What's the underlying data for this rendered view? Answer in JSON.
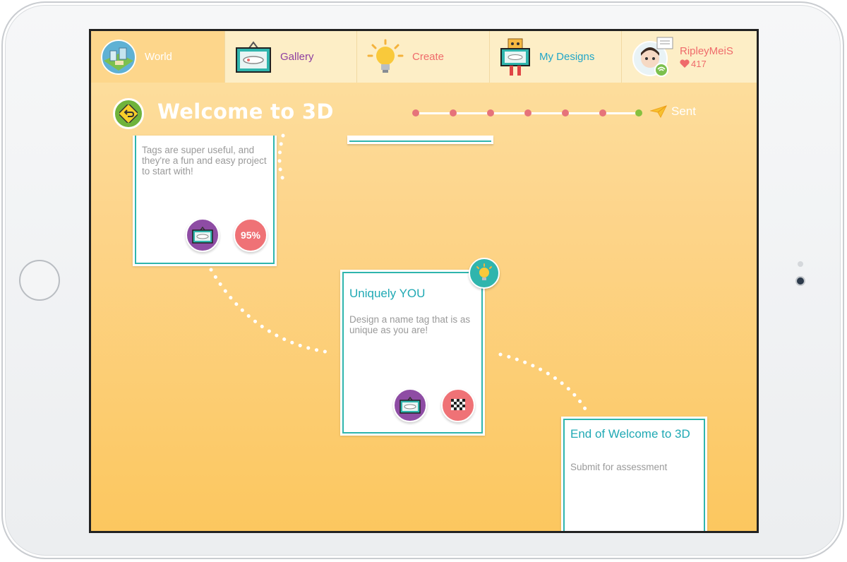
{
  "nav": {
    "tabs": [
      {
        "label": "World",
        "color": "#ffffff",
        "active": true,
        "icon": "world-icon"
      },
      {
        "label": "Gallery",
        "color": "#8e3fa0",
        "icon": "gallery-icon"
      },
      {
        "label": "Create",
        "color": "#ef6b6b",
        "icon": "lightbulb-icon"
      },
      {
        "label": "My Designs",
        "color": "#22a6c8",
        "icon": "robot-icon"
      },
      {
        "label": "RipleyMeiS",
        "color": "#ef6b6b",
        "icon": "avatar-icon"
      }
    ],
    "profile": {
      "likes": "417",
      "heart_icon": "heart-icon"
    }
  },
  "header": {
    "title": "Welcome to 3D",
    "sent_label": "Sent",
    "progress": {
      "total_steps": 7,
      "completed_steps": 6
    }
  },
  "cards": {
    "tags": {
      "description": "Tags are super useful, and they're a fun and easy project to start with!",
      "progress_badge": "95%"
    },
    "uniquely_you": {
      "title": "Uniquely YOU",
      "description": "Design a name tag that is as unique as you are!"
    },
    "end": {
      "title": "End of Welcome to 3D",
      "description": "Submit for assessment"
    }
  },
  "colors": {
    "accent_teal": "#2fb5ad",
    "background": "#fdd58c",
    "badge_purple": "#8e4ca4",
    "badge_pink": "#ef7276",
    "progress_green": "#86c03f"
  }
}
